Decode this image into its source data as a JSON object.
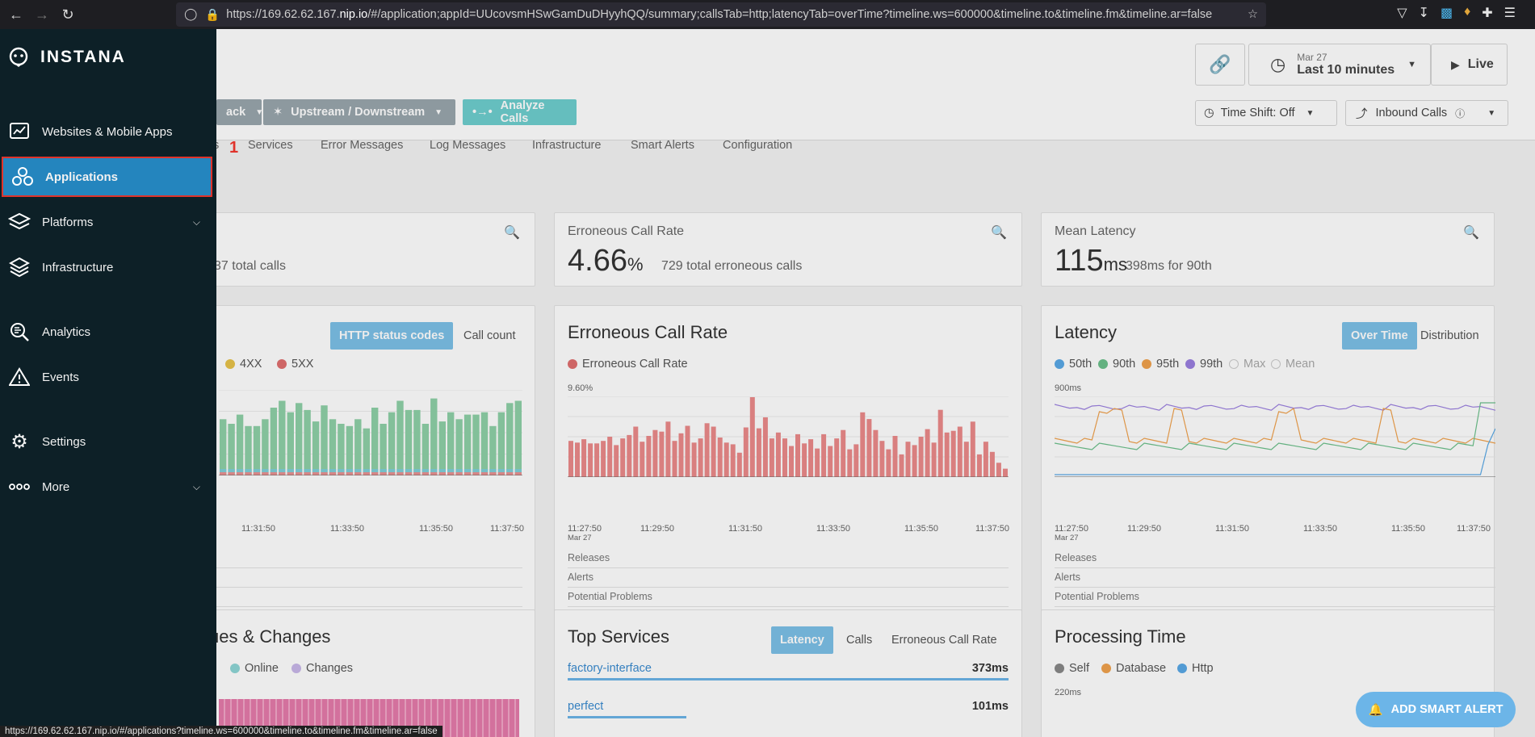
{
  "browser": {
    "url_prefix": "https://169.62.62.167.",
    "url_host": "nip.io",
    "url_path": "/#/application;appId=UUcovsmHSwGamDuDHyyhQQ/summary;callsTab=http;latencyTab=overTime?timeline.ws=600000&timeline.to&timeline.fm&timeline.ar=false",
    "status_url": "https://169.62.62.167.nip.io/#/applications?timeline.ws=600000&timeline.to&timeline.fm&timeline.ar=false"
  },
  "sidebar": {
    "brand": "INSTANA",
    "items": [
      {
        "label": "Websites & Mobile Apps",
        "icon": "monitor-icon"
      },
      {
        "label": "Applications",
        "icon": "applications-icon",
        "active": true
      },
      {
        "label": "Platforms",
        "icon": "platforms-icon",
        "expandable": true
      },
      {
        "label": "Infrastructure",
        "icon": "infrastructure-icon"
      },
      {
        "label": "Analytics",
        "icon": "analytics-icon"
      },
      {
        "label": "Events",
        "icon": "events-icon"
      },
      {
        "label": "Settings",
        "icon": "settings-icon"
      },
      {
        "label": "More",
        "icon": "more-icon",
        "expandable": true
      }
    ],
    "step_marker": "1"
  },
  "header": {
    "date": "Mar 27",
    "range": "Last 10 minutes",
    "live": "Live",
    "time_shift": "Time Shift: Off",
    "inbound": "Inbound Calls",
    "stack_fragment": "ack",
    "upstream": "Upstream / Downstream",
    "analyze": "Analyze Calls"
  },
  "tabs": [
    "s",
    "Services",
    "Error Messages",
    "Log Messages",
    "Infrastructure",
    "Smart Alerts",
    "Configuration"
  ],
  "metrics": {
    "calls_sub_fragment": "37 total calls",
    "error_label": "Erroneous Call Rate",
    "error_value": "4.66",
    "error_unit": "%",
    "error_sub": "729 total erroneous calls",
    "latency_label": "Mean Latency",
    "latency_value": "115",
    "latency_unit": "ms",
    "latency_sub": "398ms for 90th"
  },
  "calls_card": {
    "btn_active": "HTTP status codes",
    "btn_other": "Call count",
    "legend": [
      {
        "label": "4XX",
        "color": "#e8c34a"
      },
      {
        "label": "5XX",
        "color": "#e06f6f"
      }
    ],
    "x_ticks": [
      "11:31:50",
      "11:33:50",
      "11:35:50",
      "11:37:50"
    ]
  },
  "error_card": {
    "title": "Erroneous Call Rate",
    "legend": "Erroneous Call Rate",
    "y_max": "9.60%",
    "x_ticks": [
      "11:27:50",
      "11:29:50",
      "11:31:50",
      "11:33:50",
      "11:35:50",
      "11:37:50"
    ],
    "x_date": "Mar 27",
    "rows": [
      "Releases",
      "Alerts",
      "Potential Problems"
    ]
  },
  "latency_card": {
    "title": "Latency",
    "btn_active": "Over Time",
    "btn_other": "Distribution",
    "legend": [
      {
        "label": "50th",
        "color": "#5aa9e6"
      },
      {
        "label": "90th",
        "color": "#6cc08b"
      },
      {
        "label": "95th",
        "color": "#f0a24e"
      },
      {
        "label": "99th",
        "color": "#9b7fe0"
      },
      {
        "label": "Max",
        "color": "#cccccc"
      },
      {
        "label": "Mean",
        "color": "#cccccc"
      }
    ],
    "y_max": "900ms",
    "x_ticks": [
      "11:27:50",
      "11:29:50",
      "11:31:50",
      "11:33:50",
      "11:35:50",
      "11:37:50"
    ],
    "x_date": "Mar 27",
    "rows": [
      "Releases",
      "Alerts",
      "Potential Problems"
    ]
  },
  "issues_card": {
    "title_fragment": "ues & Changes",
    "legend": [
      {
        "label": "Online",
        "color": "#8fd6d6"
      },
      {
        "label": "Changes",
        "color": "#c9b8ea"
      }
    ]
  },
  "top_services": {
    "title": "Top Services",
    "btns": [
      "Latency",
      "Calls",
      "Erroneous Call Rate"
    ],
    "services": [
      {
        "name": "factory-interface",
        "value": "373ms",
        "fill": 1.0
      },
      {
        "name": "perfect",
        "value": "101ms",
        "fill": 0.27
      }
    ]
  },
  "processing": {
    "title": "Processing Time",
    "legend": [
      {
        "label": "Self",
        "color": "#888888"
      },
      {
        "label": "Database",
        "color": "#f0a24e"
      },
      {
        "label": "Http",
        "color": "#5aa9e6"
      }
    ],
    "y_max": "220ms"
  },
  "smart_alert_button": "ADD SMART ALERT",
  "chart_data": [
    {
      "type": "bar",
      "title": "Erroneous Call Rate",
      "series": [
        {
          "name": "Erroneous Call Rate",
          "values": [
            4.3,
            4.1,
            4.5,
            4.0,
            4.0,
            4.3,
            4.8,
            3.8,
            4.6,
            5.0,
            6.0,
            4.2,
            4.9,
            5.6,
            5.4,
            6.6,
            4.3,
            5.2,
            6.1,
            4.1,
            4.6,
            6.4,
            6.0,
            4.7,
            4.1,
            3.9,
            2.9,
            5.9,
            9.5,
            5.8,
            7.1,
            4.6,
            5.3,
            4.6,
            3.7,
            5.1,
            4.0,
            4.5,
            3.4,
            5.1,
            3.7,
            4.6,
            5.6,
            3.3,
            3.9,
            7.7,
            6.9,
            5.6,
            4.3,
            3.3,
            4.9,
            2.7,
            4.2,
            3.8,
            4.8,
            5.7,
            4.1,
            8.0,
            5.3,
            5.5,
            6.0,
            4.2,
            6.6,
            2.7,
            4.2,
            3.0,
            1.7,
            1.0
          ]
        }
      ],
      "ylim": [
        0,
        9.6
      ],
      "xlabel": "",
      "ylabel": ""
    }
  ]
}
